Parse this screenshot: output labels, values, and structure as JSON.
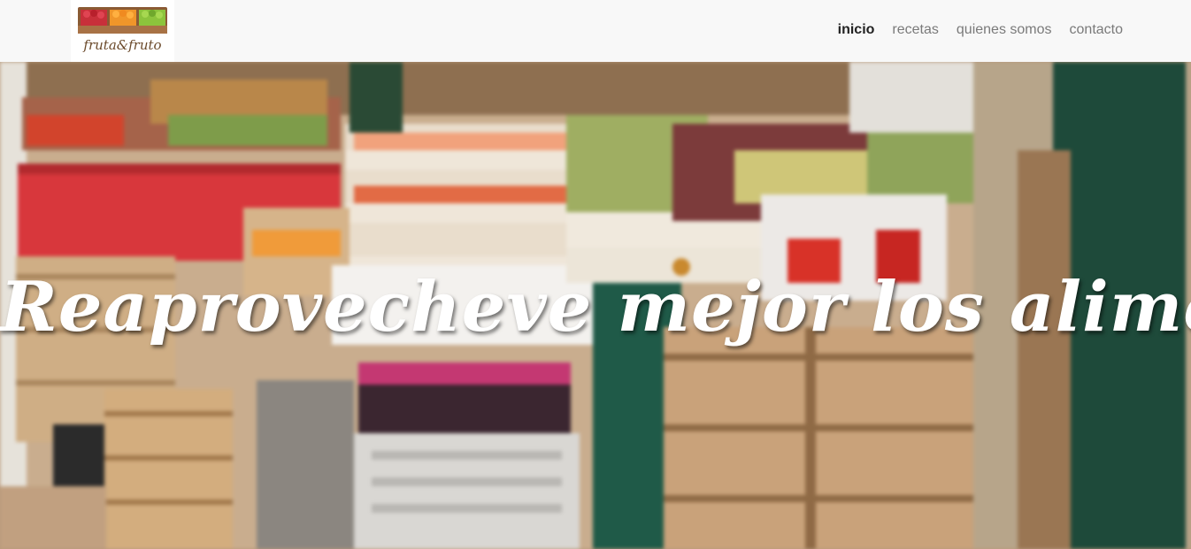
{
  "brand": {
    "logo_text": "fruta&fruto",
    "logo_icon": "fruit-crates-logo"
  },
  "nav": {
    "items": [
      {
        "label": "inicio",
        "active": true
      },
      {
        "label": "recetas",
        "active": false
      },
      {
        "label": "quienes somos",
        "active": false
      },
      {
        "label": "contacto",
        "active": false
      }
    ]
  },
  "hero": {
    "title": "Reaprovecheve mejor los alimentos",
    "background": "market-fruit-crates-photo"
  },
  "colors": {
    "navbar_bg": "#f8f8f8",
    "nav_active": "#222222",
    "nav_inactive": "#7a7a7a",
    "hero_title": "#ffffff"
  }
}
